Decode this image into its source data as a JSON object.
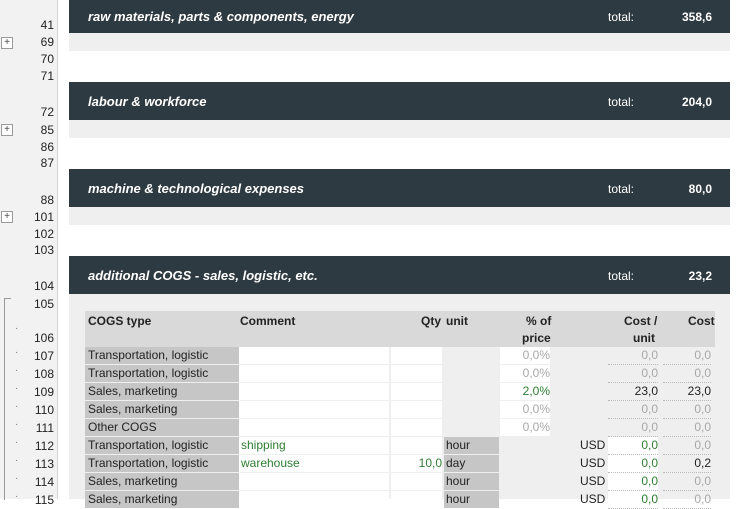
{
  "sections": [
    {
      "title": "raw materials, parts & components, energy",
      "total_label": "total:",
      "total_value": "358,6"
    },
    {
      "title": "labour & workforce",
      "total_label": "total:",
      "total_value": "204,0"
    },
    {
      "title": "machine & technological expenses",
      "total_label": "total:",
      "total_value": "80,0"
    },
    {
      "title": "additional COGS - sales, logistic, etc.",
      "total_label": "total:",
      "total_value": "23,2"
    }
  ],
  "row_numbers": [
    "41",
    "69",
    "70",
    "71",
    "72",
    "85",
    "86",
    "87",
    "88",
    "101",
    "102",
    "103",
    "104",
    "105",
    "106",
    "107",
    "108",
    "109",
    "110",
    "111",
    "112",
    "113",
    "114",
    "115"
  ],
  "table": {
    "headers": {
      "type": "COGS type",
      "comment": "Comment",
      "qty": "Qty",
      "unit": "unit",
      "pct_line1": "% of",
      "pct_line2": "price",
      "cpu_line1": "Cost /",
      "cpu_line2": "unit",
      "cost": "Cost"
    },
    "rows": [
      {
        "type": "Transportation, logistic",
        "comment": "",
        "qty": "",
        "unit": "",
        "pct": "0,0%",
        "currency": "",
        "cpu": "0,0",
        "cost": "0,0"
      },
      {
        "type": "Transportation, logistic",
        "comment": "",
        "qty": "",
        "unit": "",
        "pct": "0,0%",
        "currency": "",
        "cpu": "0,0",
        "cost": "0,0"
      },
      {
        "type": "Sales, marketing",
        "comment": "",
        "qty": "",
        "unit": "",
        "pct": "2,0%",
        "currency": "",
        "cpu": "23,0",
        "cost": "23,0"
      },
      {
        "type": "Sales, marketing",
        "comment": "",
        "qty": "",
        "unit": "",
        "pct": "0,0%",
        "currency": "",
        "cpu": "0,0",
        "cost": "0,0"
      },
      {
        "type": "Other COGS",
        "comment": "",
        "qty": "",
        "unit": "",
        "pct": "0,0%",
        "currency": "",
        "cpu": "0,0",
        "cost": "0,0"
      },
      {
        "type": "Transportation, logistic",
        "comment": "shipping",
        "qty": "",
        "unit": "hour",
        "pct": "",
        "currency": "USD",
        "cpu": "0,0",
        "cost": "0,0"
      },
      {
        "type": "Transportation, logistic",
        "comment": "warehouse",
        "qty": "10,0",
        "unit": "day",
        "pct": "",
        "currency": "USD",
        "cpu": "0,0",
        "cost": "0,2"
      },
      {
        "type": "Sales, marketing",
        "comment": "",
        "qty": "",
        "unit": "hour",
        "pct": "",
        "currency": "USD",
        "cpu": "0,0",
        "cost": "0,0"
      },
      {
        "type": "Sales, marketing",
        "comment": "",
        "qty": "",
        "unit": "hour",
        "pct": "",
        "currency": "USD",
        "cpu": "0,0",
        "cost": "0,0"
      }
    ]
  },
  "colors": {
    "band": "#2e3a41",
    "accent_green": "#2e7d32",
    "grey_cell": "#c6c6c6"
  },
  "icons": [
    "expand-group-icon"
  ]
}
